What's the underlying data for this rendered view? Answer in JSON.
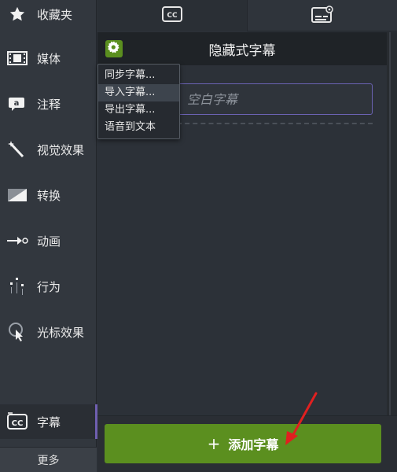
{
  "sidebar": {
    "items": [
      {
        "label": "收藏夹",
        "icon": "star-icon"
      },
      {
        "label": "媒体",
        "icon": "film-icon"
      },
      {
        "label": "注释",
        "icon": "annotation-icon"
      },
      {
        "label": "视觉效果",
        "icon": "magic-wand-icon"
      },
      {
        "label": "转换",
        "icon": "transition-icon"
      },
      {
        "label": "动画",
        "icon": "animation-icon"
      },
      {
        "label": "行为",
        "icon": "behavior-icon"
      },
      {
        "label": "光标效果",
        "icon": "cursor-effect-icon"
      },
      {
        "label": "字幕",
        "icon": "cc-icon"
      }
    ],
    "more_label": "更多"
  },
  "tabs": [
    {
      "icon": "cc-icon"
    },
    {
      "icon": "caption-settings-icon"
    }
  ],
  "panel": {
    "title": "隐藏式字幕",
    "caption_placeholder": "空白字幕"
  },
  "menu": {
    "items": [
      "同步字幕...",
      "导入字幕...",
      "导出字幕...",
      "语音到文本"
    ],
    "hovered_index": 1
  },
  "add_button": {
    "plus": "+",
    "label": "添加字幕"
  },
  "colors": {
    "accent_green": "#5b8f1f",
    "accent_purple": "#6b62b3",
    "annotation_red": "#e02020"
  }
}
